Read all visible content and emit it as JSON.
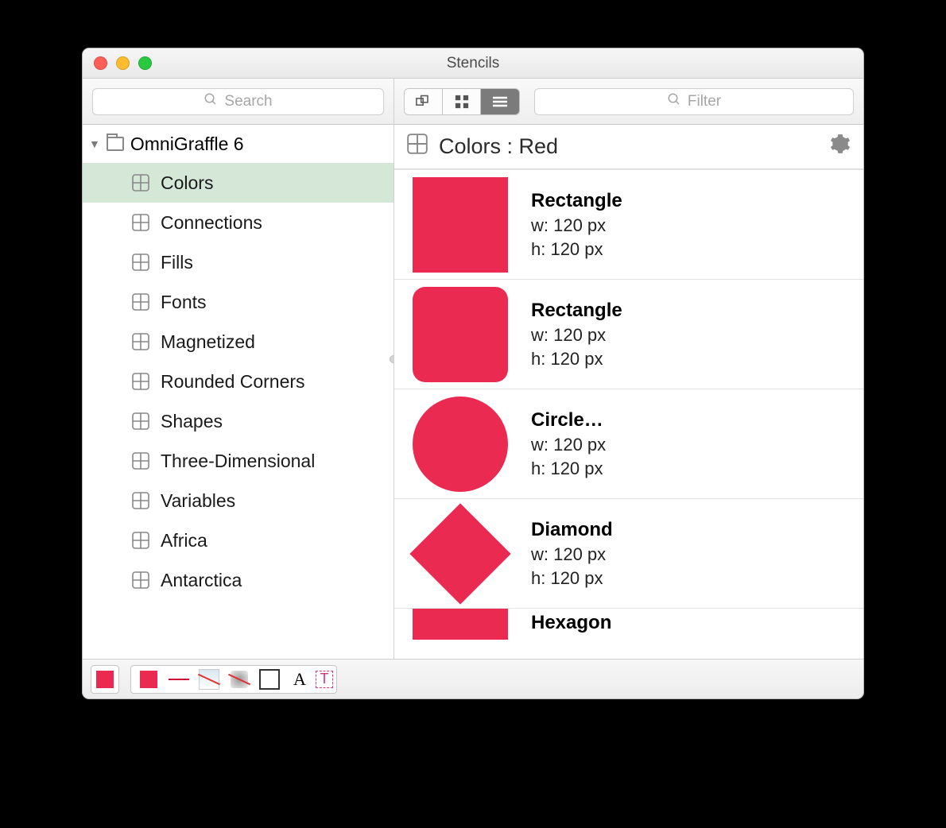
{
  "window": {
    "title": "Stencils"
  },
  "toolbar": {
    "search_placeholder": "Search",
    "filter_placeholder": "Filter"
  },
  "sidebar": {
    "root": "OmniGraffle 6",
    "items": [
      {
        "label": "Colors",
        "selected": true
      },
      {
        "label": "Connections"
      },
      {
        "label": "Fills"
      },
      {
        "label": "Fonts"
      },
      {
        "label": "Magnetized"
      },
      {
        "label": "Rounded Corners"
      },
      {
        "label": "Shapes"
      },
      {
        "label": "Three-Dimensional"
      },
      {
        "label": "Variables"
      },
      {
        "label": "Africa"
      },
      {
        "label": "Antarctica"
      }
    ]
  },
  "main": {
    "title": "Colors : Red",
    "items": [
      {
        "name": "Rectangle",
        "w": "w: 120 px",
        "h": "h: 120 px",
        "shape": "rect"
      },
      {
        "name": "Rectangle",
        "w": "w: 120 px",
        "h": "h: 120 px",
        "shape": "rrect"
      },
      {
        "name": "Circle…",
        "w": "w: 120 px",
        "h": "h: 120 px",
        "shape": "circle"
      },
      {
        "name": "Diamond",
        "w": "w: 120 px",
        "h": "h: 120 px",
        "shape": "diamond"
      },
      {
        "name": "Hexagon",
        "w": "",
        "h": "",
        "shape": "hex",
        "partial": true
      }
    ]
  },
  "colors": {
    "accent": "#eb2a52"
  },
  "footer": {
    "chips": [
      "fill",
      "line",
      "gradient",
      "blur",
      "outline",
      "text",
      "textbox"
    ]
  }
}
